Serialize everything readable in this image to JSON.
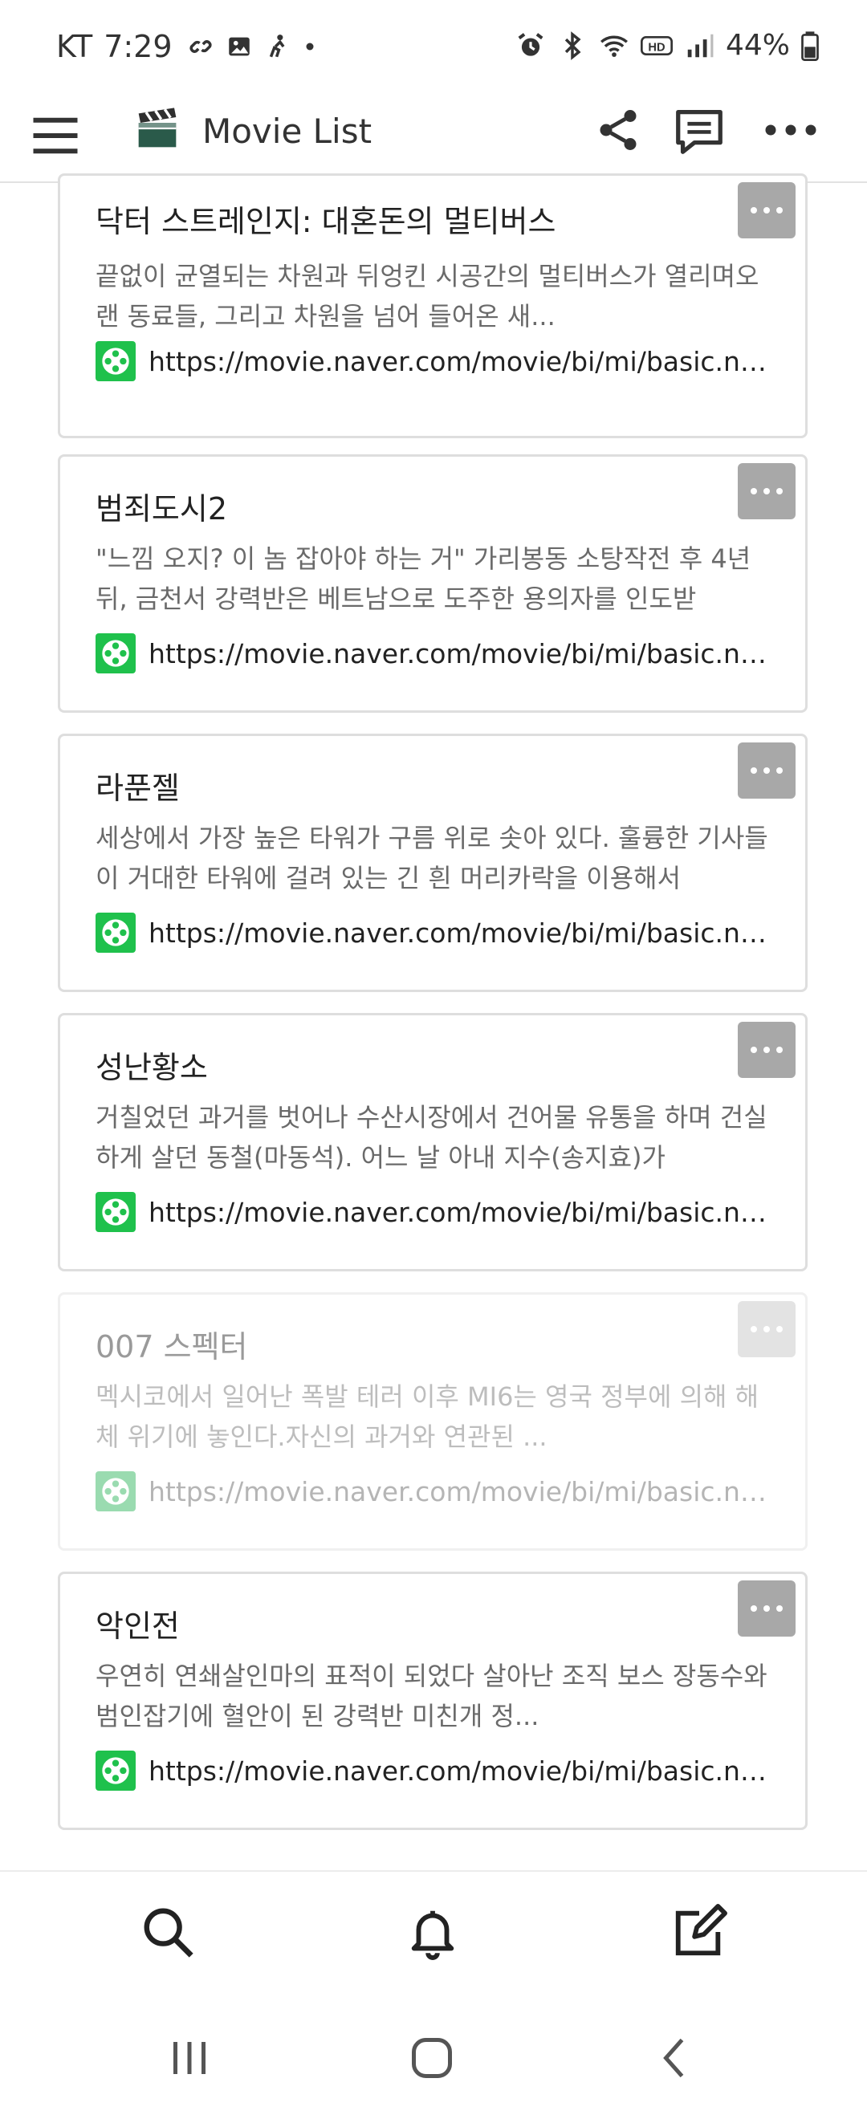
{
  "status": {
    "carrier": "KT",
    "time": "7:29",
    "battery": "44%",
    "left_icons": [
      "link-icon",
      "image-icon",
      "accessibility-icon",
      "dot-icon"
    ],
    "right_icons": [
      "alarm-icon",
      "bluetooth-icon",
      "wifi-icon",
      "hd-icon",
      "signal-icon",
      "battery-icon"
    ]
  },
  "app": {
    "title": "Movie List",
    "logo_icon": "clapperboard-icon"
  },
  "cards": [
    {
      "title": "닥터 스트레인지: 대혼돈의 멀티버스",
      "desc": "끝없이 균열되는 차원과 뒤엉킨 시공간의 멀티버스가 열리며오랜 동료들, 그리고 차원을 넘어 들어온 새...",
      "url": "https://movie.naver.com/movie/bi/mi/basic.naver?code=",
      "faded": false
    },
    {
      "title": "범죄도시2",
      "desc": "\"느낌 오지? 이 놈 잡아야 하는 거\" 가리봉동 소탕작전 후 4년 뒤, 금천서 강력반은 베트남으로 도주한 용의자를 인도받",
      "url": "https://movie.naver.com/movie/bi/mi/basic.naver?code=",
      "faded": false
    },
    {
      "title": "라푼젤",
      "desc": "세상에서 가장 높은 타워가 구름 위로 솟아 있다. 훌륭한 기사들이 거대한 타워에 걸려 있는 긴 흰 머리카락을 이용해서",
      "url": "https://movie.naver.com/movie/bi/mi/basic.naver?code=",
      "faded": false
    },
    {
      "title": "성난황소",
      "desc": "거칠었던 과거를 벗어나 수산시장에서 건어물 유통을 하며 건실하게 살던 동철(마동석). 어느 날 아내 지수(송지효)가",
      "url": "https://movie.naver.com/movie/bi/mi/basic.naver?code=",
      "faded": false
    },
    {
      "title": "007 스펙터",
      "desc": "멕시코에서 일어난 폭발 테러 이후 MI6는 영국 정부에 의해 해체 위기에 놓인다.자신의 과거와 연관된 ...",
      "url": "https://movie.naver.com/movie/bi/mi/basic.naver?code=",
      "faded": true
    },
    {
      "title": "악인전",
      "desc": "우연히 연쇄살인마의 표적이 되었다 살아난 조직 보스 장동수와 범인잡기에 혈안이 된 강력반 미친개 정...",
      "url": "https://movie.naver.com/movie/bi/mi/basic.naver?code=",
      "faded": false
    }
  ],
  "bottom_bar": {
    "icons": [
      "search-icon",
      "bell-icon",
      "edit-icon"
    ]
  },
  "nav": {
    "icons": [
      "recent-apps-icon",
      "home-icon",
      "back-icon"
    ]
  },
  "colors": {
    "accent_green": "#1fc14c",
    "more_button": "#a8a8a8",
    "card_border": "#dedede"
  }
}
